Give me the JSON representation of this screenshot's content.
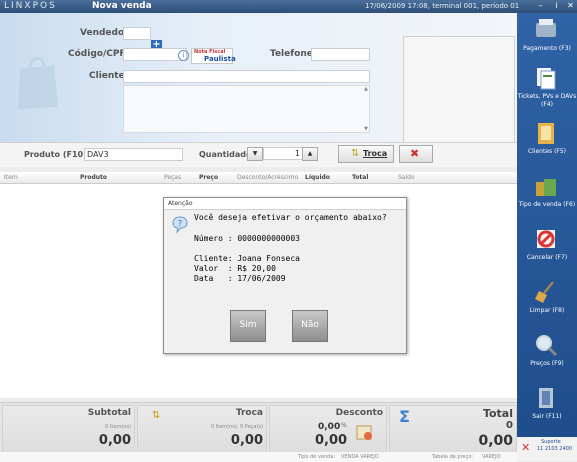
{
  "titlebar": {
    "brand": "LINXPOS",
    "title": "Nova venda",
    "status": "17/06/2009 17:08, terminal 001, período 01"
  },
  "header": {
    "vendedor_label": "Vendedor",
    "codigo_label": "Código/CPF",
    "telefone_label": "Telefone",
    "cliente_label": "Cliente",
    "nfp_text_top": "Nota Fiscal",
    "nfp_text_bottom": "Paulista"
  },
  "sidebar": [
    {
      "label": "Pagamento (F3)"
    },
    {
      "label": "Tickets, PVs e DAVs (F4)"
    },
    {
      "label": "Clientes (F5)"
    },
    {
      "label": "Tipo de venda (F6)"
    },
    {
      "label": "Cancelar (F7)"
    },
    {
      "label": "Limpar (F8)"
    },
    {
      "label": "Preços (F9)"
    },
    {
      "label": "Sair (F11)"
    }
  ],
  "support": {
    "label": "Suporte",
    "phone": "11 2103 2400"
  },
  "product": {
    "label": "Produto (F10)",
    "value": "DAV3",
    "qty_label": "Quantidade",
    "qty_value": "1",
    "troca_label": "Troca"
  },
  "grid": {
    "columns": [
      "Item",
      "Produto",
      "Peças",
      "Preço",
      "Desconto/Acréscimo",
      "Líquido",
      "Total",
      "Saldo"
    ]
  },
  "dialog": {
    "title": "Atenção",
    "question": "Você deseja efetivar o orçamento abaixo?",
    "numero": "Número : 0000000000003",
    "cliente": "Cliente: Joana Fonseca",
    "valor": "Valor  : R$ 20,00",
    "data": "Data   : 17/06/2009",
    "yes_label": "Sim",
    "no_label": "Não"
  },
  "totals": {
    "subtotal_label": "Subtotal",
    "subtotal_items": "0 Item(ns)",
    "subtotal_value": "0,00",
    "troca_label": "Troca",
    "troca_items": "0 Item(ns), 0 Peça(s)",
    "troca_value": "0,00",
    "desconto_label": "Desconto",
    "desconto_value": "0,00",
    "desconto_pct": "%",
    "desconto_value2": "0,00",
    "total_label": "Total",
    "total_count": "0",
    "total_value": "0,00"
  },
  "footer": {
    "tipo_label": "Tipo de venda:",
    "tipo_value": "VENDA VAREJO",
    "tabela_label": "Tabela de preço:",
    "tabela_value": "VAREJO"
  },
  "colors": {
    "titlebar": "#2d4f78",
    "sidebar": "#1e4c8a",
    "accent": "#2a6ab7"
  }
}
